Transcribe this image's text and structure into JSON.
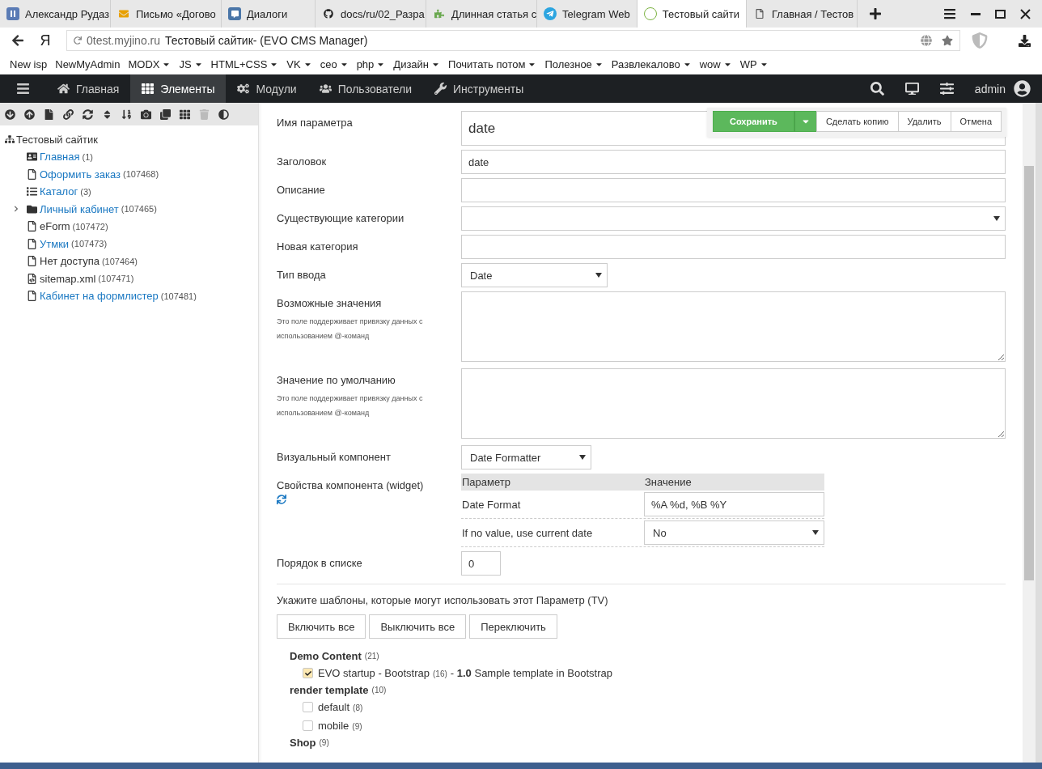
{
  "browser": {
    "tabs": [
      {
        "title": "Александр Рудаз",
        "kind": "letter",
        "selected": false
      },
      {
        "title": "Письмо «Догово",
        "kind": "mail",
        "selected": false
      },
      {
        "title": "Диалоги",
        "kind": "chat",
        "selected": false
      },
      {
        "title": "docs/ru/02_Разра",
        "kind": "github",
        "selected": false
      },
      {
        "title": "Длинная статья с",
        "kind": "puzzle",
        "selected": false
      },
      {
        "title": "Telegram Web",
        "kind": "telegram",
        "selected": false
      },
      {
        "title": "Тестовый сайти",
        "kind": "evo",
        "selected": true
      },
      {
        "title": "Главная / Тестов",
        "kind": "page",
        "selected": false
      }
    ],
    "logo": "Я",
    "address_host": "0test.myjino.ru",
    "address_title": "Тестовый сайтик- (EVO CMS Manager)",
    "bookmarks": [
      {
        "label": "New isp",
        "dropdown": false
      },
      {
        "label": "NewMyAdmin",
        "dropdown": false
      },
      {
        "label": "MODX",
        "dropdown": true
      },
      {
        "label": "JS",
        "dropdown": true
      },
      {
        "label": "HTML+CSS",
        "dropdown": true
      },
      {
        "label": "VK",
        "dropdown": true
      },
      {
        "label": "ceo",
        "dropdown": true
      },
      {
        "label": "php",
        "dropdown": true
      },
      {
        "label": "Дизайн",
        "dropdown": true
      },
      {
        "label": "Почитать потом",
        "dropdown": true
      },
      {
        "label": "Полезное",
        "dropdown": true
      },
      {
        "label": "Развлекалово",
        "dropdown": true
      },
      {
        "label": "wow",
        "dropdown": true
      },
      {
        "label": "WP",
        "dropdown": true
      }
    ]
  },
  "nav": {
    "items": [
      {
        "label": "Главная",
        "kind": "home",
        "selected": false
      },
      {
        "label": "Элементы",
        "kind": "grid",
        "selected": true
      },
      {
        "label": "Модули",
        "kind": "cogs",
        "selected": false
      },
      {
        "label": "Пользователи",
        "kind": "users",
        "selected": false
      },
      {
        "label": "Инструменты",
        "kind": "wrench",
        "selected": false
      }
    ],
    "user": "admin"
  },
  "tree": {
    "root": "Тестовый сайтик",
    "children": [
      {
        "label": "Главная",
        "id_text": "(1)",
        "kind": "home",
        "published": true
      },
      {
        "label": "Оформить заказ",
        "id_text": "(107468)",
        "kind": "page",
        "published": true
      },
      {
        "label": "Каталог",
        "id_text": "(3)",
        "kind": "list",
        "published": true
      },
      {
        "label": "Личный кабинет",
        "id_text": "(107465)",
        "kind": "folder",
        "published": true,
        "expanded": false
      },
      {
        "label": "eForm",
        "id_text": "(107472)",
        "kind": "page",
        "published": false
      },
      {
        "label": "Утмки",
        "id_text": "(107473)",
        "kind": "page",
        "published": true
      },
      {
        "label": "Нет доступа",
        "id_text": "(107464)",
        "kind": "page",
        "published": false
      },
      {
        "label": "sitemap.xml",
        "id_text": "(107471)",
        "kind": "code",
        "published": false
      },
      {
        "label": "Кабинет на формлистер",
        "id_text": "(107481)",
        "kind": "page",
        "published": true
      }
    ]
  },
  "actions": [
    {
      "label": "Сохранить",
      "kind": "primary"
    },
    {
      "label": "Сделать копию",
      "kind": "default"
    },
    {
      "label": "Удалить",
      "kind": "default"
    },
    {
      "label": "Отмена",
      "kind": "default"
    }
  ],
  "form": [
    {
      "label": "Имя параметра",
      "kind": "name",
      "value": "date"
    },
    {
      "label": "Заголовок",
      "kind": "input",
      "value": "date"
    },
    {
      "label": "Описание",
      "kind": "input"
    },
    {
      "label": "Существующие категории",
      "kind": "wide-select"
    },
    {
      "label": "Новая категория",
      "kind": "input"
    },
    {
      "label": "Тип ввода",
      "kind": "select",
      "value": "Date"
    },
    {
      "label": "Возможные значения",
      "kind": "textarea",
      "note": "Это поле поддерживает привязку данных с использованием @-команд"
    },
    {
      "label": "Значение по умолчанию",
      "kind": "textarea",
      "note": "Это поле поддерживает привязку данных с использованием @-команд"
    },
    {
      "label": "Визуальный компонент",
      "kind": "select",
      "value": "Date Formatter"
    },
    {
      "label": "Свойства компонента (widget)",
      "kind": "widget",
      "columns": [
        "Параметр",
        "Значение"
      ],
      "rows": [
        {
          "label": "Date Format",
          "kind": "input",
          "value": "%A %d, %B %Y"
        },
        {
          "label": "If no value, use current date",
          "kind": "select",
          "value": "No"
        }
      ]
    },
    {
      "label": "Порядок в списке",
      "kind": "number",
      "value": "0"
    }
  ],
  "templates": {
    "intro": "Укажите шаблоны, которые могут использовать этот Параметр (TV)",
    "buttons": [
      "Включить все",
      "Выключить все",
      "Переключить"
    ],
    "groups": [
      {
        "name": "Demo Content",
        "count": "(21)",
        "items": [
          {
            "label": "EVO startup - Bootstrap",
            "count": "(16)",
            "description": "- **1.0** Sample template in Bootstrap",
            "checked": true
          }
        ]
      },
      {
        "name": "render template",
        "count": "(10)",
        "items": [
          {
            "label": "default",
            "count": "(8)",
            "checked": false
          },
          {
            "label": "mobile",
            "count": "(9)",
            "checked": false
          }
        ]
      },
      {
        "name": "Shop",
        "count": "(9)"
      }
    ]
  }
}
